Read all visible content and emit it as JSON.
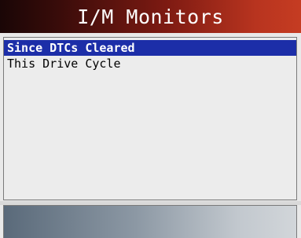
{
  "title": "I/M Monitors",
  "menu": {
    "items": [
      {
        "label": "Since DTCs Cleared",
        "selected": true
      },
      {
        "label": "This Drive Cycle",
        "selected": false
      }
    ]
  },
  "colors": {
    "title_bar_accent": "#b8341f",
    "selection_highlight": "#1c2ea8",
    "panel_background": "#ececec"
  }
}
